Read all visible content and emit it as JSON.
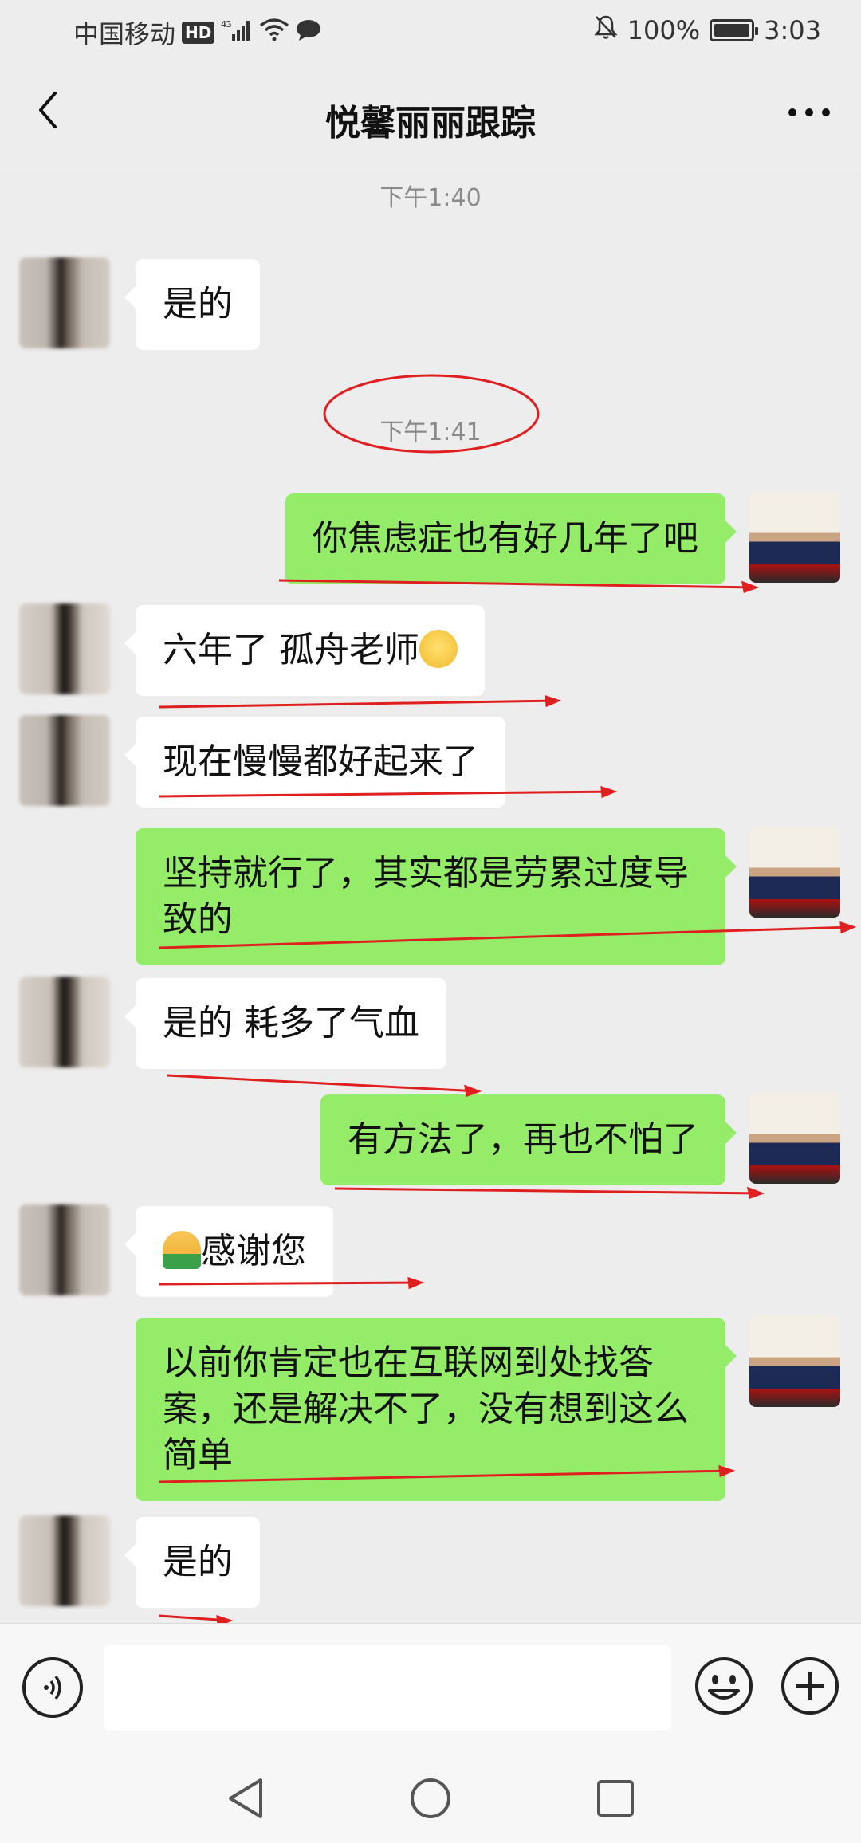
{
  "status_bar": {
    "carrier": "中国移动",
    "hd": "HD",
    "network": "4G",
    "battery": "100%",
    "time": "3:03"
  },
  "header": {
    "title": "悦馨丽丽跟踪"
  },
  "messages": {
    "ts1": "下午1:40",
    "m1": "是的",
    "ts2": "下午1:41",
    "m2": "你焦虑症也有好几年了吧",
    "m3": "六年了 孤舟老师",
    "m4": "现在慢慢都好起来了",
    "m5a": "坚持就行了，其实都是劳累过度导",
    "m5b": "致的",
    "m6": "是的 耗多了气血",
    "m7": "有方法了，再也不怕了",
    "m8": "感谢您",
    "m9a": "以前你肯定也在互联网到处找答",
    "m9b": "案，还是解决不了，没有想到这么",
    "m9c": "简单",
    "m10": "是的"
  },
  "icons": {
    "back": "chevron-left-icon",
    "more": "more-horizontal-icon",
    "voice": "voice-icon",
    "emoji": "emoji-icon",
    "plus": "plus-icon"
  },
  "colors": {
    "outgoing_bubble": "#95ec69",
    "incoming_bubble": "#ffffff",
    "background": "#ededed",
    "annotation": "#e02020"
  }
}
